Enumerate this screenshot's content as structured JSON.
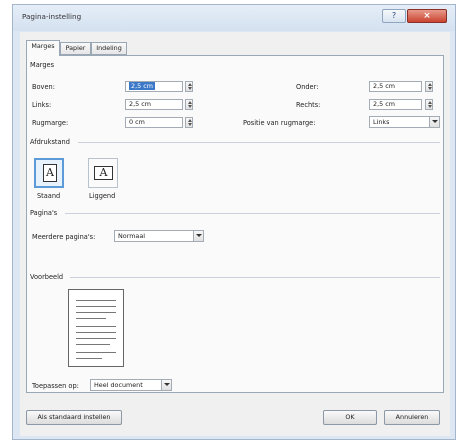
{
  "window": {
    "title": "Pagina-instelling",
    "help_glyph": "?",
    "close_glyph": "×"
  },
  "tabs": [
    {
      "label": "Marges",
      "active": true
    },
    {
      "label": "Papier",
      "active": false
    },
    {
      "label": "Indeling",
      "active": false
    }
  ],
  "margins": {
    "section_label": "Marges",
    "boven": {
      "label": "Boven:",
      "value": "2,5 cm"
    },
    "onder": {
      "label": "Onder:",
      "value": "2,5 cm"
    },
    "links": {
      "label": "Links:",
      "value": "2,5 cm"
    },
    "rechts": {
      "label": "Rechts:",
      "value": "2,5 cm"
    },
    "rugmarge": {
      "label": "Rugmarge:",
      "value": "0 cm"
    },
    "rug_positie": {
      "label": "Positie van rugmarge:",
      "value": "Links"
    }
  },
  "orientation": {
    "section_label": "Afdrukstand",
    "icon_glyph": "A",
    "staand": "Staand",
    "liggend": "Liggend",
    "selected": "staand"
  },
  "pages": {
    "section_label": "Pagina's",
    "multiple_label": "Meerdere pagina's:",
    "multiple_value": "Normaal"
  },
  "preview": {
    "section_label": "Voorbeeld"
  },
  "apply": {
    "label": "Toepassen op:",
    "value": "Heel document"
  },
  "buttons": {
    "default": "Als standaard instellen",
    "ok": "OK",
    "cancel": "Annuleren"
  }
}
